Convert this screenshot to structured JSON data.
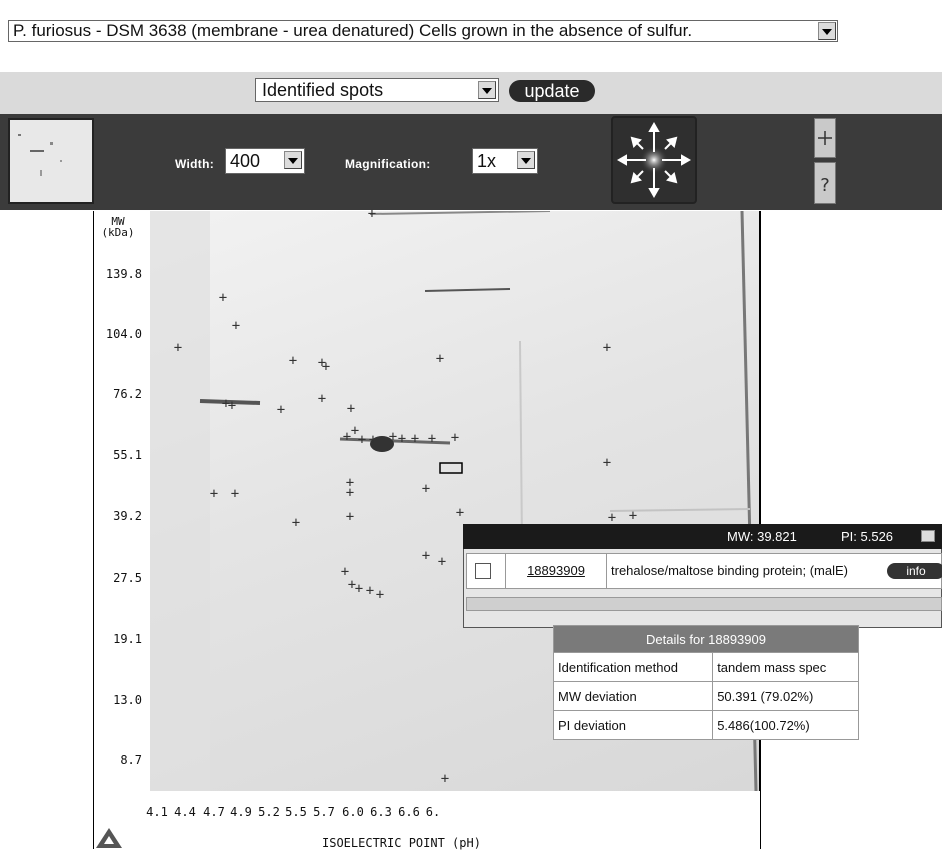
{
  "sample_select": {
    "value": "P. furiosus - DSM 3638 (membrane - urea denatured) Cells grown in the absence of sulfur."
  },
  "spot_filter": {
    "value": "Identified spots"
  },
  "update_label": "update",
  "toolbar": {
    "width_label": "Width:",
    "width_value": "400",
    "magnification_label": "Magnification:",
    "magnification_value": "1x"
  },
  "gel": {
    "mw_axis_title": [
      "MW",
      "(kDa)"
    ],
    "mw_ticks": [
      "139.8",
      "104.0",
      "76.2",
      "55.1",
      "39.2",
      "27.5",
      "19.1",
      "13.0",
      "8.7"
    ],
    "pi_ticks": [
      "4.1",
      "4.4",
      "4.7",
      "4.9",
      "5.2",
      "5.5",
      "5.7",
      "6.0",
      "6.3",
      "6.6",
      "6."
    ],
    "pi_axis_title": "ISOELECTRIC POINT (pH)"
  },
  "popup": {
    "mw_readout": "MW: 39.821",
    "pi_readout": "PI: 5.526",
    "protein_id": "18893909",
    "protein_name": "trehalose/maltose binding protein; (malE)",
    "info_label": "info"
  },
  "details": {
    "title": "Details for 18893909",
    "rows": [
      {
        "label": "Identification method",
        "value": "tandem mass spec"
      },
      {
        "label": "MW deviation",
        "value": "50.391 (79.02%)"
      },
      {
        "label": "PI deviation",
        "value": "5.486(100.72%)"
      }
    ]
  },
  "colors": {
    "toolbar": "#3b3b3b",
    "band": "#dadada",
    "popup_header": "#1a1a1a",
    "details_header": "#7a7a7a"
  }
}
